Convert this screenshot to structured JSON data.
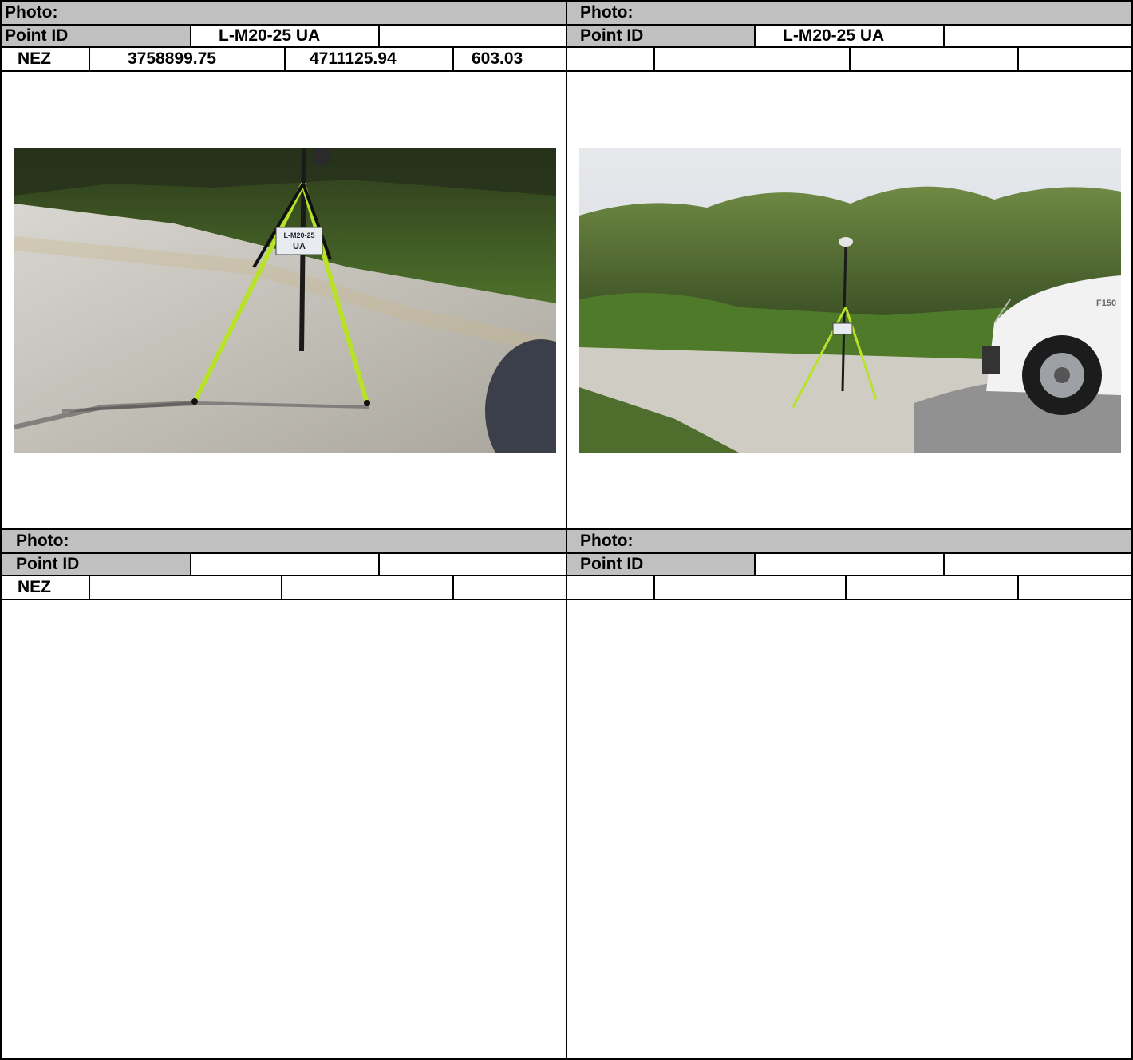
{
  "labels": {
    "photo": "Photo:",
    "point_id": "Point ID",
    "nez": "NEZ"
  },
  "panels": [
    {
      "point_id": "L-M20-25 UA",
      "point_extra": "",
      "northing": "3758899.75",
      "easting": "4711125.94",
      "elevation": "603.03",
      "photo_desc": "Survey GPS rod on lime-green bipod on gravel road beside grassy bank",
      "sign_text": [
        "L-M20-25",
        "UA"
      ]
    },
    {
      "point_id": "L-M20-25 UA",
      "point_extra": "",
      "northing": "",
      "easting": "",
      "elevation": "",
      "photo_desc": "Wide view of survey rod on gravel road with tree line and white pickup truck",
      "truck_badge": "F150"
    },
    {
      "point_id": "",
      "point_extra": "",
      "northing": "",
      "easting": "",
      "elevation": ""
    },
    {
      "point_id": "",
      "point_extra": "",
      "northing": "",
      "easting": "",
      "elevation": ""
    }
  ]
}
